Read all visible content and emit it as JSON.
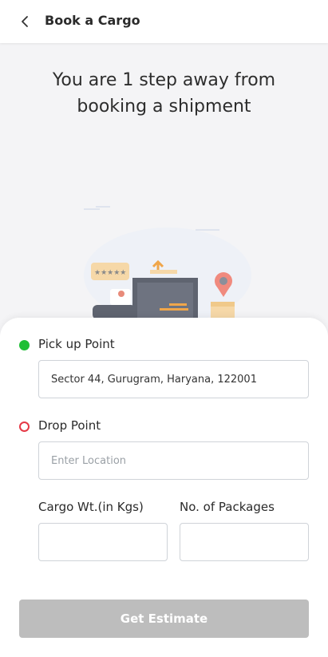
{
  "header": {
    "title": "Book a Cargo",
    "back_icon": "chevron-left-icon"
  },
  "hero": {
    "headline_line1": "You are 1 step away from",
    "headline_line2": "booking a shipment",
    "illustration": "cargo-desk-map-pin-illustration"
  },
  "form": {
    "pickup": {
      "label": "Pick up Point",
      "value": "Sector 44, Gurugram, Haryana, 122001",
      "indicator_color": "#1fbf35"
    },
    "drop": {
      "label": "Drop Point",
      "placeholder": "Enter Location",
      "value": "",
      "indicator_color": "#e53946"
    },
    "weight": {
      "label": "Cargo Wt.(in Kgs)",
      "value": ""
    },
    "packages": {
      "label": "No. of Packages",
      "value": ""
    },
    "submit_label": "Get Estimate",
    "submit_color": "#bdbdbd"
  }
}
